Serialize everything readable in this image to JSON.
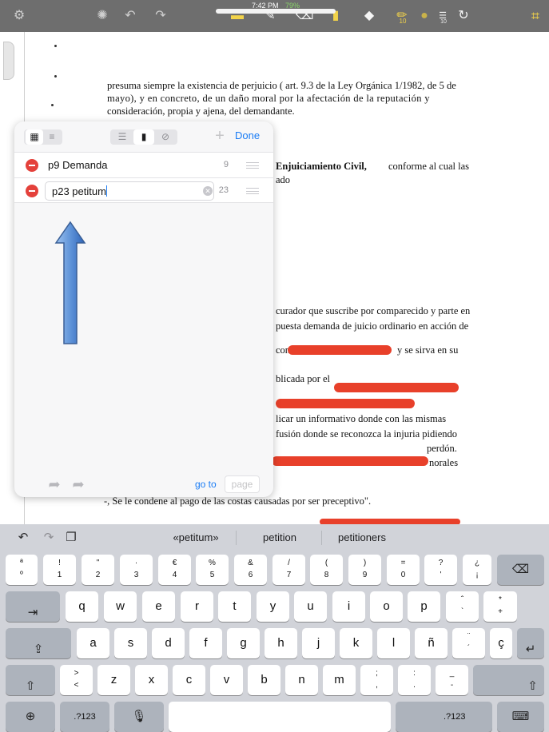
{
  "status_bar": {
    "time": "7:42 PM",
    "battery": "79%"
  },
  "toolbar": {
    "page_number": "10",
    "text_size": "10",
    "left_icons": [
      "gear-icon",
      "undo-icon",
      "redo-icon"
    ],
    "tool_icons": [
      "highlighter-icon",
      "pen-icon",
      "eraser-icon",
      "bookmark-icon",
      "eraser-icon",
      "highlighter-active-icon",
      "color-dot-icon",
      "lines-icon",
      "lasso-icon",
      "crop-icon"
    ]
  },
  "document": {
    "lines": [
      "presuma siempre la existencia de perjuicio ( art. 9.3 de la Ley Orgánica 1/1982, de 5 de",
      "mayo), y en concreto, de un daño moral por la afectación de la reputación y",
      "consideración, propia y ajena, del demandante.",
      "Enjuiciamiento Civil,",
      "conforme al cual las",
      "ado",
      "curador que suscribe por comparecido y parte en",
      "puesta demanda de juicio ordinario en acción de",
      "con",
      "y se sirva en su",
      "blicada por el",
      "licar un informativo donde con las mismas",
      "fusión donde se reconozca la injuria pidiendo",
      "perdón.",
      "norales",
      "-, Se le condene al pago de las costas causadas por ser preceptivo\"."
    ]
  },
  "bookmarks_panel": {
    "done_label": "Done",
    "add_icon": "plus-icon",
    "view_icons": [
      "grid-icon",
      "list-icon"
    ],
    "mode_icons": [
      "outline-icon",
      "bookmark-icon",
      "annotation-icon"
    ],
    "items": [
      {
        "label": "p9 Demanda",
        "page": "9"
      },
      {
        "label": "p23 petitum",
        "page": "23",
        "editing": true
      }
    ],
    "goto_label": "go to",
    "page_placeholder": "page"
  },
  "keyboard": {
    "suggestions": [
      "«petitum»",
      "petition",
      "petitioners"
    ],
    "number_row": [
      {
        "top": "ª",
        "bottom": "º"
      },
      {
        "top": "!",
        "bottom": "1"
      },
      {
        "top": "\"",
        "bottom": "2"
      },
      {
        "top": "·",
        "bottom": "3"
      },
      {
        "top": "€",
        "bottom": "4"
      },
      {
        "top": "%",
        "bottom": "5"
      },
      {
        "top": "&",
        "bottom": "6"
      },
      {
        "top": "/",
        "bottom": "7"
      },
      {
        "top": "(",
        "bottom": "8"
      },
      {
        "top": ")",
        "bottom": "9"
      },
      {
        "top": "=",
        "bottom": "0"
      },
      {
        "top": "?",
        "bottom": "'"
      },
      {
        "top": "¿",
        "bottom": "¡"
      }
    ],
    "row_q": [
      "q",
      "w",
      "e",
      "r",
      "t",
      "y",
      "u",
      "i",
      "o",
      "p"
    ],
    "row_q_extra": [
      {
        "top": "ˆ",
        "bottom": "`"
      },
      {
        "top": "*",
        "bottom": "+"
      }
    ],
    "row_a": [
      "a",
      "s",
      "d",
      "f",
      "g",
      "h",
      "j",
      "k",
      "l",
      "ñ"
    ],
    "row_a_extra": [
      {
        "top": "¨",
        "bottom": "´"
      },
      {
        "top": "",
        "bottom": "ç"
      }
    ],
    "row_z_extra_start": {
      "top": ">",
      "bottom": "<"
    },
    "row_z": [
      "z",
      "x",
      "c",
      "v",
      "b",
      "n",
      "m"
    ],
    "row_z_extra_end": [
      {
        "top": ";",
        "bottom": ","
      },
      {
        "top": ":",
        "bottom": "."
      },
      {
        "top": "_",
        "bottom": "-"
      }
    ],
    "numbers_label": ".?123"
  }
}
